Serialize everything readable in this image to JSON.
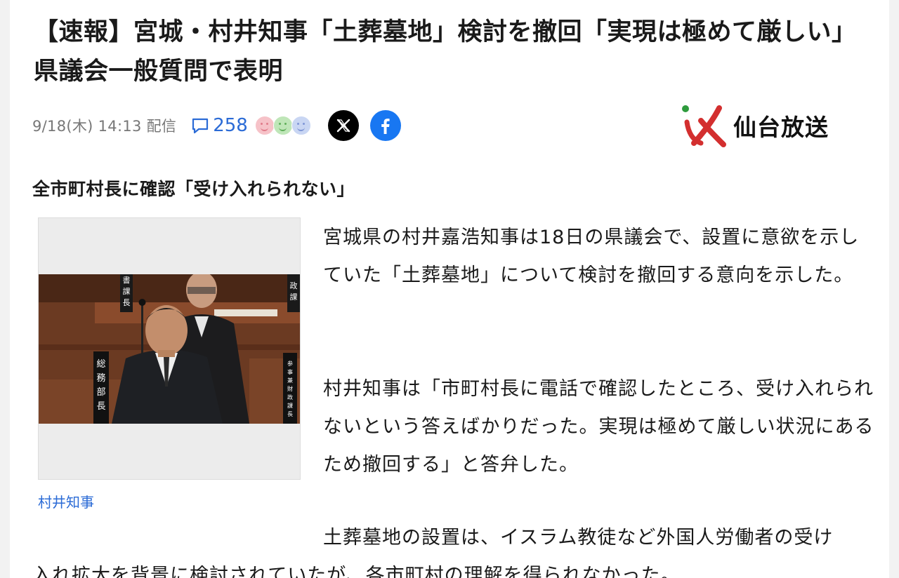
{
  "article": {
    "headline": "【速報】宮城・村井知事「土葬墓地」検討を撤回「実現は極めて厳しい」県議会一般質問で表明",
    "date": "9/18(木) 14:13 配信",
    "comment_count": "258",
    "publisher": "仙台放送",
    "subheading": "全市町村長に確認「受け入れられない」",
    "image_caption": "村井知事",
    "paragraph1": "宮城県の村井嘉浩知事は18日の県議会で、設置に意欲を示していた「土葬墓地」について検討を撤回する意向を示した。",
    "paragraph2": "村井知事は「市町村長に電話で確認したところ、受け入れられないという答えばかりだった。実現は極めて厳しい状況にあるため撤回する」と答弁した。",
    "paragraph3_line1": "土葬墓地の設置は、イスラム教徒など外国人労働者の受け",
    "paragraph3_line2": "入れ拡大を背景に検討されていたが、各市町村の理解を得られなかった。"
  },
  "photo": {
    "nameplate_left": "総務部長",
    "nameplate_top_left": "書課長",
    "nameplate_top_right": "政課",
    "nameplate_right": "参事兼財政課長"
  },
  "icons": {
    "comment": "comment-bubble-icon",
    "reactions": [
      "smile-face-pink",
      "smile-face-green",
      "smile-face-blue"
    ],
    "share": [
      "x-icon",
      "facebook-icon"
    ]
  },
  "colors": {
    "link": "#2b6bd6",
    "facebook": "#1877f2",
    "logo_red": "#d32f2f",
    "logo_green": "#2e9b3d"
  }
}
